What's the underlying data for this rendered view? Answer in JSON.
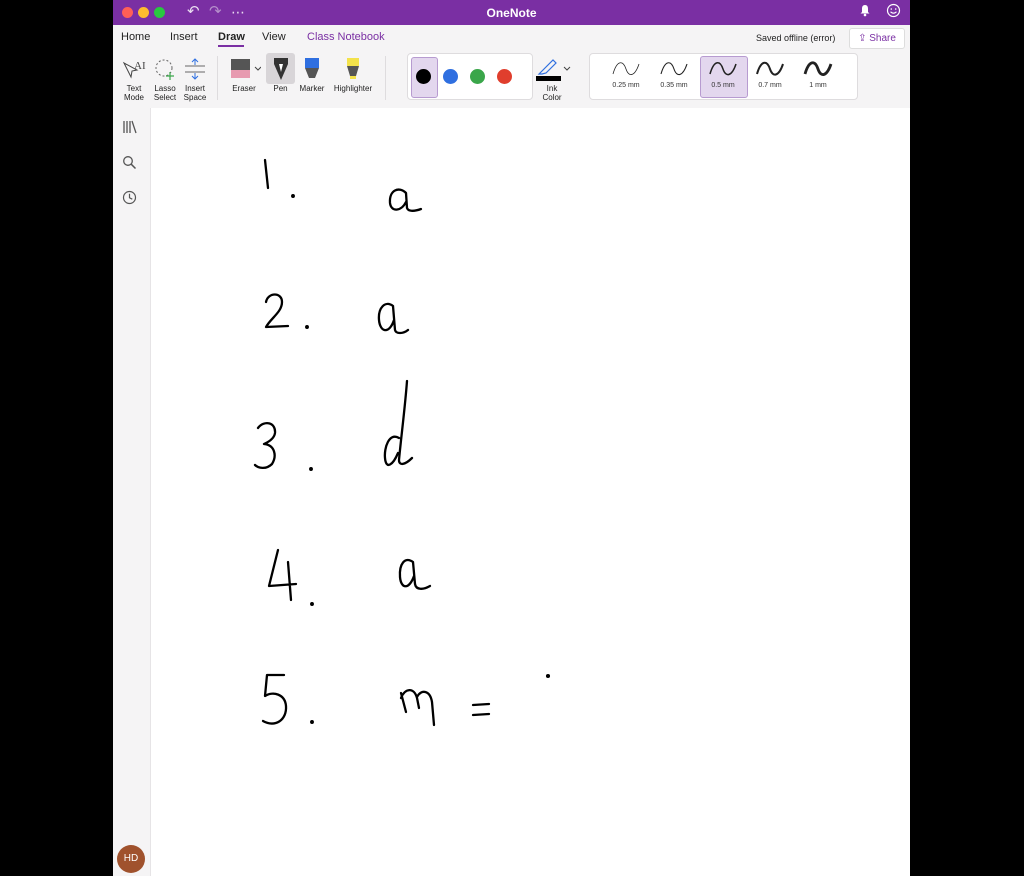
{
  "app": {
    "title": "OneNote"
  },
  "titlebar": {
    "undo_icon": "undo-icon",
    "redo_icon": "redo-icon",
    "more": "⋯",
    "bell_icon": "bell-icon",
    "feedback_icon": "smiley-icon"
  },
  "tabs": [
    {
      "label": "Home"
    },
    {
      "label": "Insert"
    },
    {
      "label": "Draw",
      "active": true
    },
    {
      "label": "View"
    },
    {
      "label": "Class Notebook"
    }
  ],
  "status": {
    "saved": "Saved offline (error)"
  },
  "share": {
    "label": "Share"
  },
  "tools": {
    "text_mode": [
      "Text",
      "Mode"
    ],
    "lasso": [
      "Lasso",
      "Select"
    ],
    "insert_space": [
      "Insert",
      "Space"
    ],
    "eraser": "Eraser",
    "pen": "Pen",
    "marker": "Marker",
    "highlighter": "Highlighter",
    "ink_color": [
      "Ink",
      "Color"
    ]
  },
  "ink_colors": [
    "#000000",
    "#2f6fe0",
    "#3aa64a",
    "#e03e2d"
  ],
  "selected_color": "#000000",
  "widths": [
    "0.25 mm",
    "0.35 mm",
    "0.5 mm",
    "0.7 mm",
    "1 mm"
  ],
  "selected_width": "0.5 mm",
  "sidebar": {
    "icons": [
      "notebooks-icon",
      "search-icon",
      "recent-icon"
    ]
  },
  "user": {
    "initials": "HD"
  },
  "page": {
    "handwriting": [
      {
        "number": "1.",
        "answer": "a"
      },
      {
        "number": "2.",
        "answer": "a"
      },
      {
        "number": "3.",
        "answer": "d"
      },
      {
        "number": "4.",
        "answer": "a"
      },
      {
        "number": "5.",
        "answer": "m ="
      }
    ]
  }
}
